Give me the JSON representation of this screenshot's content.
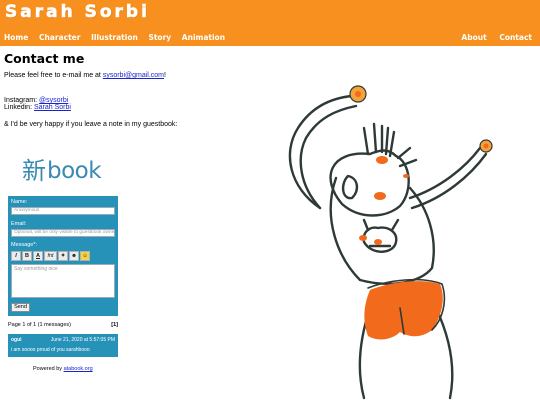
{
  "header": {
    "title": "Sarah Sorbi",
    "nav_left": [
      "Home",
      "Character",
      "Illustration",
      "Story",
      "Animation"
    ],
    "nav_right": [
      "About",
      "Contact"
    ]
  },
  "content": {
    "heading": "Contact me",
    "email_prefix": "Please feel free to e-mail me at ",
    "email": "sysorbi@gmail.com",
    "email_suffix": "!",
    "instagram_label": "Instagram: ",
    "instagram_handle": "@sysorbi",
    "linkedin_label": "Linkedin: ",
    "linkedin_name": "Sarah Sorbi",
    "guestbook_note": "& I'd be very happy if you leave a note in my guestbook:"
  },
  "guestbook": {
    "logo_kanji": "新",
    "logo_word": "book",
    "name_label": "Name:",
    "name_placeholder": "Anonymous",
    "email_label": "Email:",
    "email_placeholder": "Optional, will be only visible to guestbook owner",
    "message_label": "Message*:",
    "tools": [
      "I",
      "B",
      "A",
      "fnt",
      "✦",
      "☻",
      "☺"
    ],
    "message_placeholder": "Say something nice",
    "send_label": "Send",
    "pager_text": "Page 1 of 1 (1 messages)",
    "pager_page": "[1]",
    "entry": {
      "author": "ogui",
      "date": "June 21, 2020 at 5:57:05 PM",
      "message": "i am soooo proud of you sarahbooo"
    },
    "powered_prefix": "Powered by ",
    "powered_link": "atabook.org"
  },
  "colors": {
    "header_orange": "#f7901e",
    "guestbook_blue": "#2792b8",
    "link_blue": "#1a25cc",
    "drawing_orange": "#f26a1b",
    "drawing_outline": "#2e3a36"
  }
}
